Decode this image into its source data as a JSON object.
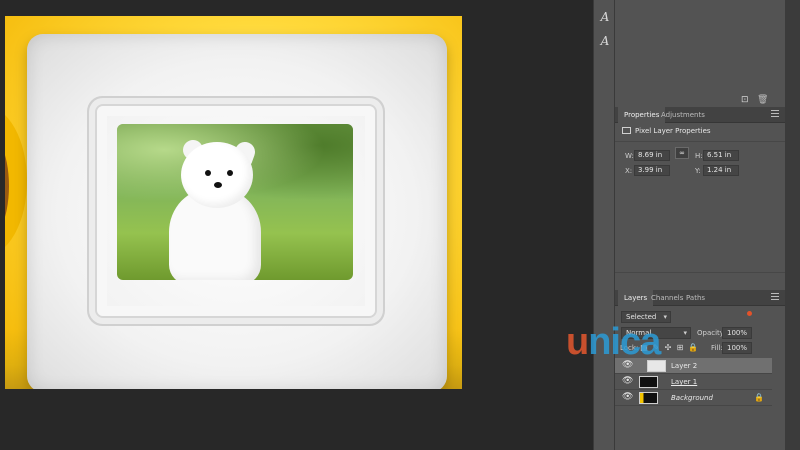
{
  "colors": {
    "accent": "#e3522a",
    "panel": "#535353",
    "bg": "#282828"
  },
  "toolstrip": {
    "char_icon": "A",
    "para_icon": "A"
  },
  "properties_panel": {
    "tabs": [
      "Properties",
      "Adjustments"
    ],
    "active_tab": "Properties",
    "title": "Pixel Layer Properties",
    "W": "8.69 in",
    "H": "6.51 in",
    "X": "3.99 in",
    "Y": "1.24 in",
    "labels": {
      "w": "W:",
      "h": "H:",
      "x": "X:",
      "y": "Y:"
    },
    "link_icon": "link-icon"
  },
  "layers_panel": {
    "tabs": [
      "Layers",
      "Channels",
      "Paths"
    ],
    "active_tab": "Layers",
    "filter": "Selected",
    "blend_mode": "Normal",
    "opacity_label": "Opacity:",
    "opacity": "100%",
    "lock_label": "Lock:",
    "fill_label": "Fill:",
    "fill": "100%",
    "layers": [
      {
        "name": "Layer 2",
        "selected": true
      },
      {
        "name": "Layer 1",
        "selected": false
      },
      {
        "name": "Background",
        "selected": false,
        "locked": true
      }
    ]
  },
  "watermark": {
    "first": "u",
    "rest": "nica"
  },
  "canvas": {
    "description_icon": "photo-frame-with-puppy"
  }
}
